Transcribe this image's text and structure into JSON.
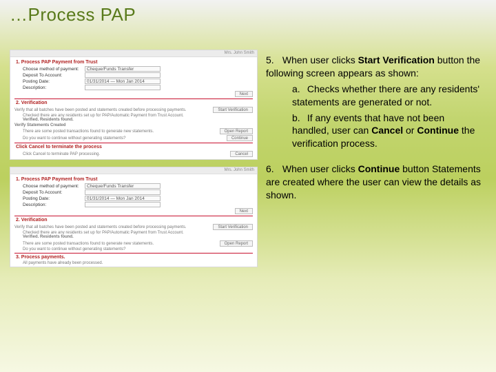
{
  "title": "…Process PAP",
  "right": {
    "item5_num": "5.",
    "item5_pre": "When user clicks ",
    "item5_bold1": "Start Verification",
    "item5_post": " button the following screen appears as shown:",
    "item5a_label": "a.",
    "item5a_text": "Checks whether there are any residents' statements are generated or not.",
    "item5b_label": "b.",
    "item5b_pre": "If any events that have not been handled, user can ",
    "item5b_bold1": "Cancel",
    "item5b_mid": " or ",
    "item5b_bold2": "Continue",
    "item5b_post": " the verification process.",
    "item6_num": "6.",
    "item6_pre": "When user clicks ",
    "item6_bold1": "Continue",
    "item6_post": " button Statements are created where the user can view the details as shown."
  },
  "shot": {
    "userline": "Mrs. John Smith",
    "hdr1": "1. Process PAP Payment from Trust",
    "lbl_method": "Choose method of payment:",
    "val_method": "Cheque/Funds Transfer",
    "lbl_deposit": "Deposit To Account:",
    "val_deposit": "",
    "lbl_posting": "Posting Date:",
    "val_posting": "01/31/2014 — Mon Jan 2014",
    "lbl_desc": "Description:",
    "btn_next": "Next",
    "hdr2": "2. Verification",
    "verify_line": "Verify that all batches have been posted and statements created before processing payments.",
    "btn_startver": "Start Verification",
    "check_line_a": "Checked there are any residents set up for PAP/Automatic Payment from Trust Account.",
    "check_found": "Verified. Residents found.",
    "verify_sub": "Verify Statements Created",
    "verify_sub_line1": "There are some posted transactions found to generate new statements.",
    "verify_sub_line2": "Do you want to continue without generating statements?",
    "btn_openreport": "Open Report",
    "btn_continue": "Continue",
    "cancel_hdr": "Click Cancel to terminate the process",
    "cancel_line": "Click Cancel to terminate PAP processing.",
    "btn_cancel": "Cancel",
    "hdr3": "3. Process payments.",
    "footer": "All payments have already been processed."
  }
}
